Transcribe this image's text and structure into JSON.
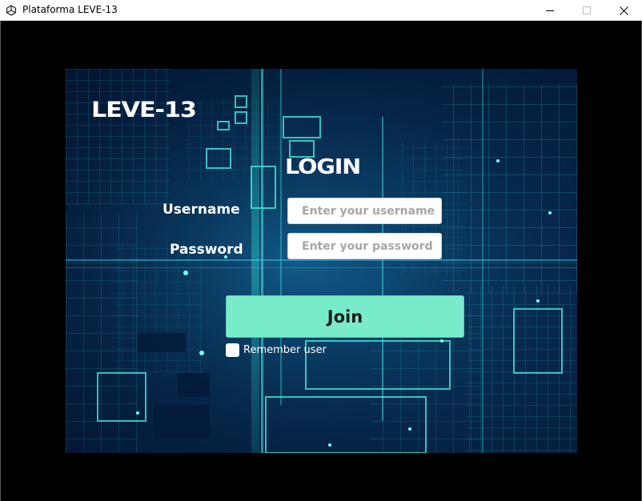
{
  "window": {
    "title": "Plataforma LEVE-13",
    "icon": "unity-icon",
    "controls": [
      "minimize",
      "maximize",
      "close"
    ]
  },
  "app": {
    "logo": "LEVE-13",
    "heading": "LOGIN"
  },
  "form": {
    "username_label": "Username",
    "username_placeholder": "Enter your username",
    "username_value": "",
    "password_label": "Password",
    "password_placeholder": "Enter your password",
    "password_value": "",
    "join_label": "Join",
    "remember_label": "Remember user",
    "remember_checked": false
  },
  "colors": {
    "join_button": "#78ecca",
    "background_grid": "#22f0d8"
  }
}
